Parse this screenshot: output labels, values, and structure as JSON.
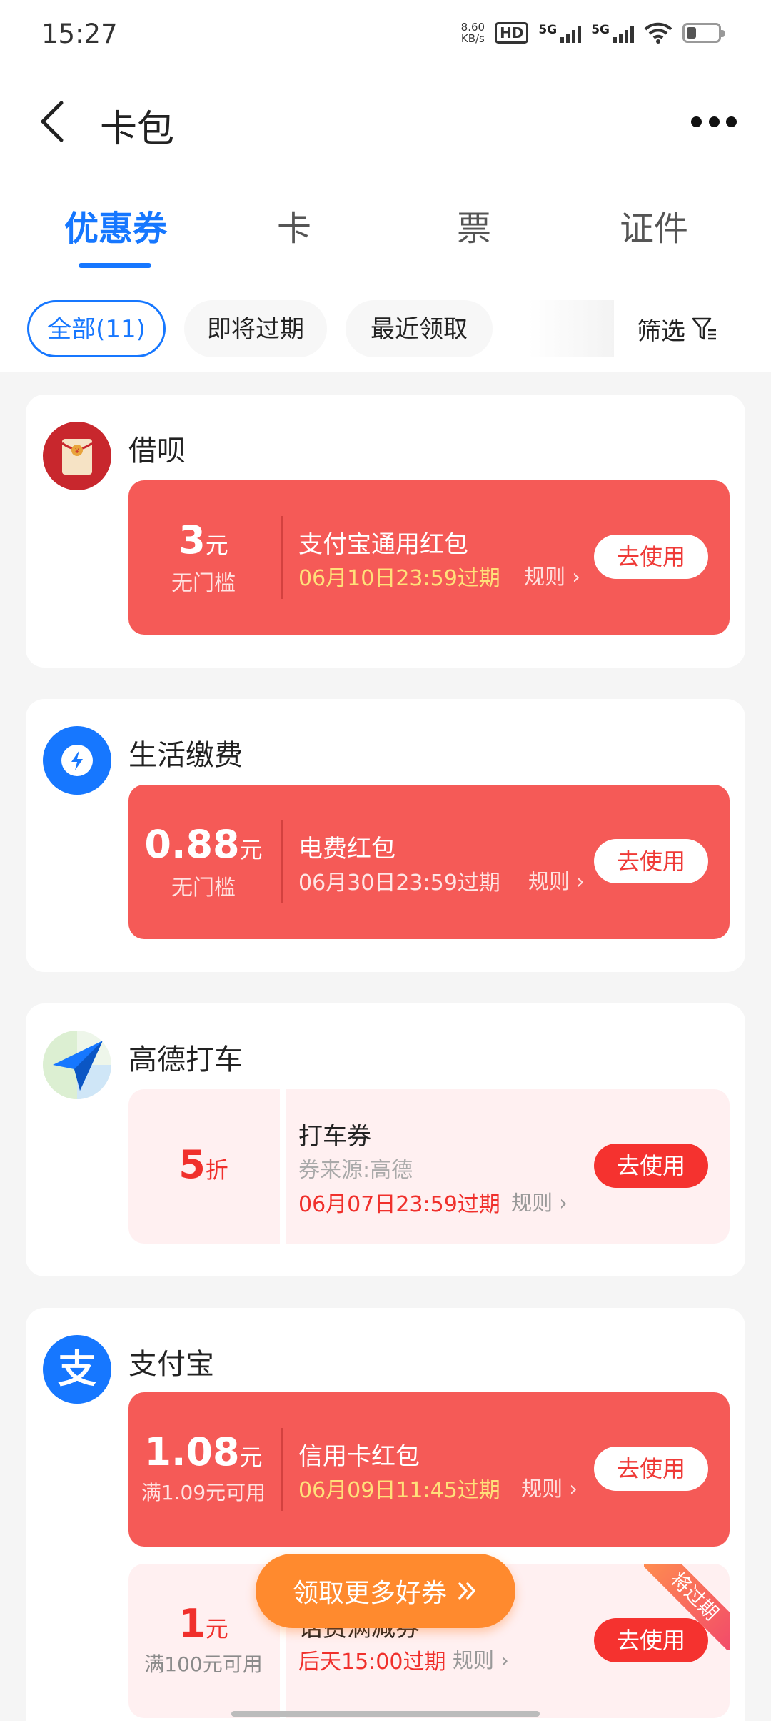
{
  "status_bar": {
    "time": "15:27",
    "net_speed_value": "8.60",
    "net_speed_unit": "KB/s",
    "hd_label": "HD",
    "sim1_label": "5G",
    "sim2_label": "5G",
    "battery_level": 0.3
  },
  "header": {
    "title": "卡包"
  },
  "tabs": [
    {
      "label": "优惠券",
      "active": true
    },
    {
      "label": "卡",
      "active": false
    },
    {
      "label": "票",
      "active": false
    },
    {
      "label": "证件",
      "active": false
    }
  ],
  "filters": {
    "chips": [
      {
        "label": "全部(11)",
        "active": true
      },
      {
        "label": "即将过期",
        "active": false
      },
      {
        "label": "最近领取",
        "active": false
      }
    ],
    "filter_label": "筛选"
  },
  "groups": [
    {
      "brand": "借呗",
      "coupons": [
        {
          "value": "3",
          "unit": "元",
          "condition": "无门槛",
          "name": "支付宝通用红包",
          "expiry": "06月10日23:59过期",
          "rule": "规则",
          "button": "去使用"
        }
      ]
    },
    {
      "brand": "生活缴费",
      "coupons": [
        {
          "value": "0.88",
          "unit": "元",
          "condition": "无门槛",
          "name": "电费红包",
          "expiry": "06月30日23:59过期",
          "rule": "规则",
          "button": "去使用"
        }
      ]
    },
    {
      "brand": "高德打车",
      "coupons": [
        {
          "value": "5",
          "unit": "折",
          "name": "打车券",
          "source": "券来源:高德",
          "expiry": "06月07日23:59过期",
          "rule": "规则",
          "button": "去使用"
        }
      ]
    },
    {
      "brand": "支付宝",
      "coupons": [
        {
          "value": "1.08",
          "unit": "元",
          "condition": "满1.09元可用",
          "name": "信用卡红包",
          "expiry": "06月09日11:45过期",
          "rule": "规则",
          "button": "去使用"
        },
        {
          "value": "1",
          "unit": "元",
          "condition": "满100元可用",
          "name": "话费满减券",
          "expiry": "后天15:00过期",
          "rule": "规则",
          "button": "去使用",
          "ribbon": "将过期"
        }
      ]
    }
  ],
  "floating_button": {
    "label": "领取更多好券"
  },
  "colors": {
    "accent_blue": "#1677ff",
    "coupon_red": "#f55a57",
    "coupon_pink": "#fff0f1",
    "orange_button": "#ff8a2e"
  }
}
